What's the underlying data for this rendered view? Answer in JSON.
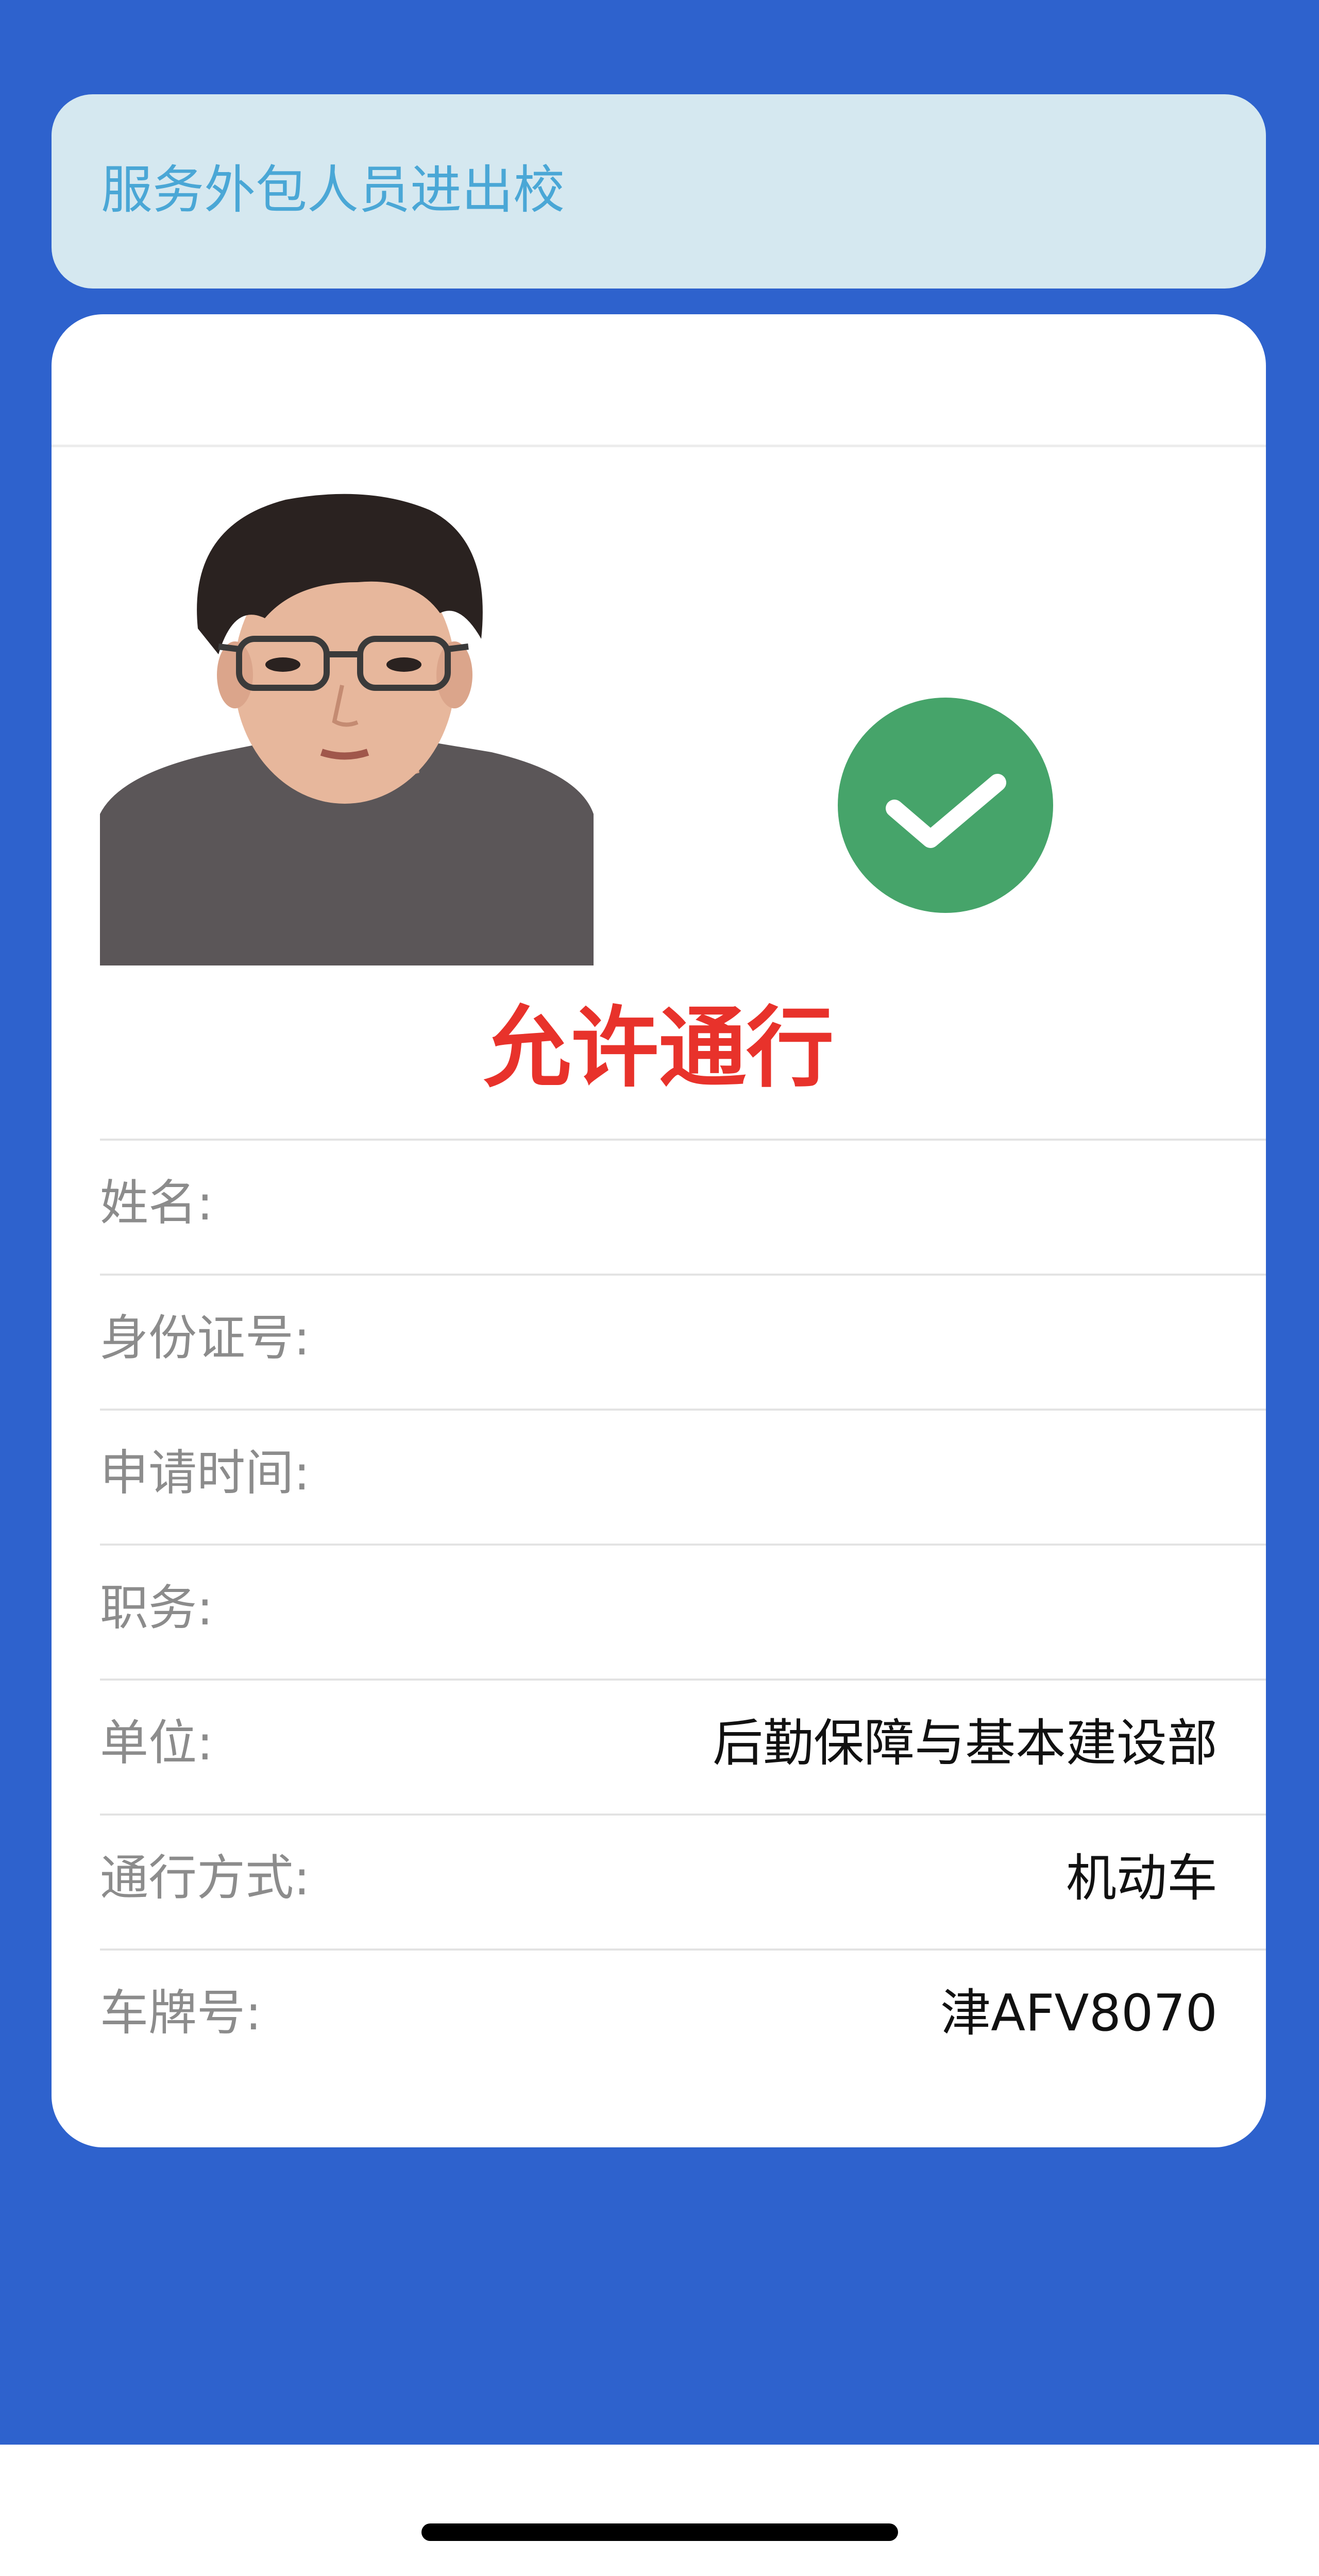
{
  "header": {
    "title": "服务外包人员进出校"
  },
  "status": {
    "text": "允许通行",
    "icon": "check-circle-icon",
    "icon_color": "#46a46a"
  },
  "info_rows": [
    {
      "label": "姓名:",
      "value": ""
    },
    {
      "label": "身份证号:",
      "value": ""
    },
    {
      "label": "申请时间:",
      "value": ""
    },
    {
      "label": "职务:",
      "value": ""
    },
    {
      "label": "单位:",
      "value": "后勤保障与基本建设部"
    },
    {
      "label": "通行方式:",
      "value": "机动车"
    },
    {
      "label": "车牌号:",
      "value": "津AFV8070"
    }
  ],
  "colors": {
    "background": "#2e62cd",
    "header_card": "#d5e8f0",
    "header_text": "#4aa7d6",
    "status_text": "#e8322b"
  }
}
